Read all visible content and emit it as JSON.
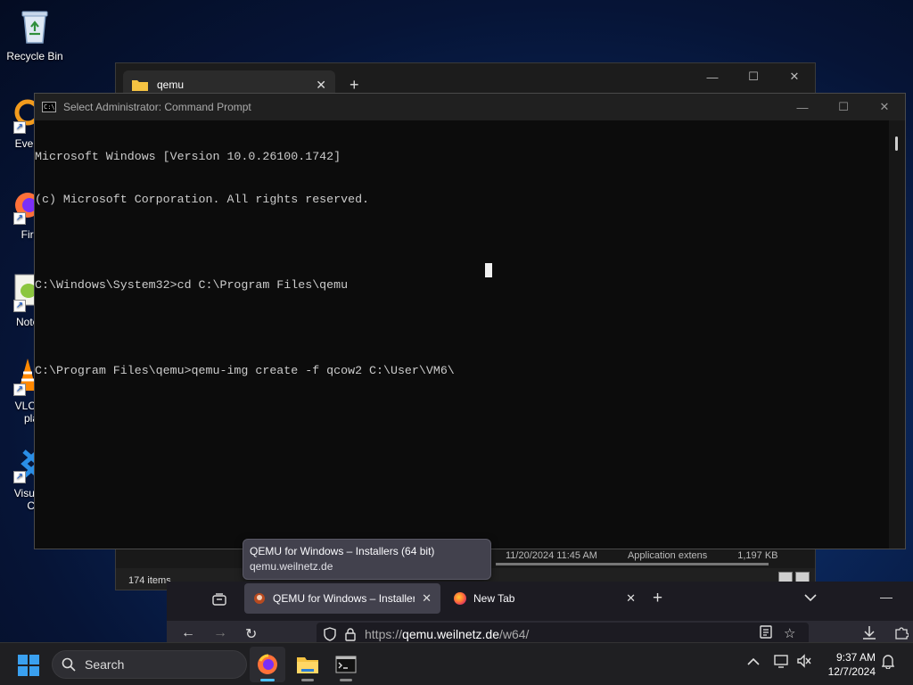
{
  "desktop": {
    "icons": [
      {
        "label": "Recycle Bin",
        "icon": "recycle-bin-icon"
      },
      {
        "label": "Every",
        "icon": "everything-search-icon"
      },
      {
        "label": "Fire",
        "icon": "firefox-icon"
      },
      {
        "label": "Notep",
        "icon": "notepad-plus-plus-icon"
      },
      {
        "label": "VLC r",
        "label2": "pla",
        "icon": "vlc-icon"
      },
      {
        "label": "Visual",
        "label2": "Co",
        "icon": "vscode-icon"
      }
    ]
  },
  "explorer": {
    "tab_title": "qemu",
    "status": "174 items",
    "row_peek": {
      "date": "11/20/2024 11:45 AM",
      "type": "Application extens",
      "size": "1,197 KB"
    }
  },
  "cmd": {
    "title": "Select Administrator: Command Prompt",
    "lines": [
      "Microsoft Windows [Version 10.0.26100.1742]",
      "(c) Microsoft Corporation. All rights reserved.",
      "",
      "C:\\Windows\\System32>cd C:\\Program Files\\qemu",
      "",
      "C:\\Program Files\\qemu>qemu-img create -f qcow2 C:\\User\\VM6\\"
    ]
  },
  "firefox": {
    "tabs": [
      {
        "label": "QEMU for Windows – Installers",
        "active": true
      },
      {
        "label": "New Tab",
        "active": false
      }
    ],
    "url_prefix": "https://",
    "url_domain": "qemu.weilnetz.de",
    "url_path": "/w64/",
    "tooltip": {
      "title": "QEMU for Windows – Installers (64 bit)",
      "domain": "qemu.weilnetz.de"
    }
  },
  "taskbar": {
    "search_placeholder": "Search",
    "time": "9:37 AM",
    "date": "12/7/2024",
    "apps": [
      "firefox-icon",
      "file-explorer-icon",
      "terminal-icon"
    ]
  },
  "colors": {
    "accent": "#4cc2ff",
    "console_text": "#cccccc",
    "console_bg": "#0c0c0c",
    "firefox_bg": "#1c1b22"
  }
}
